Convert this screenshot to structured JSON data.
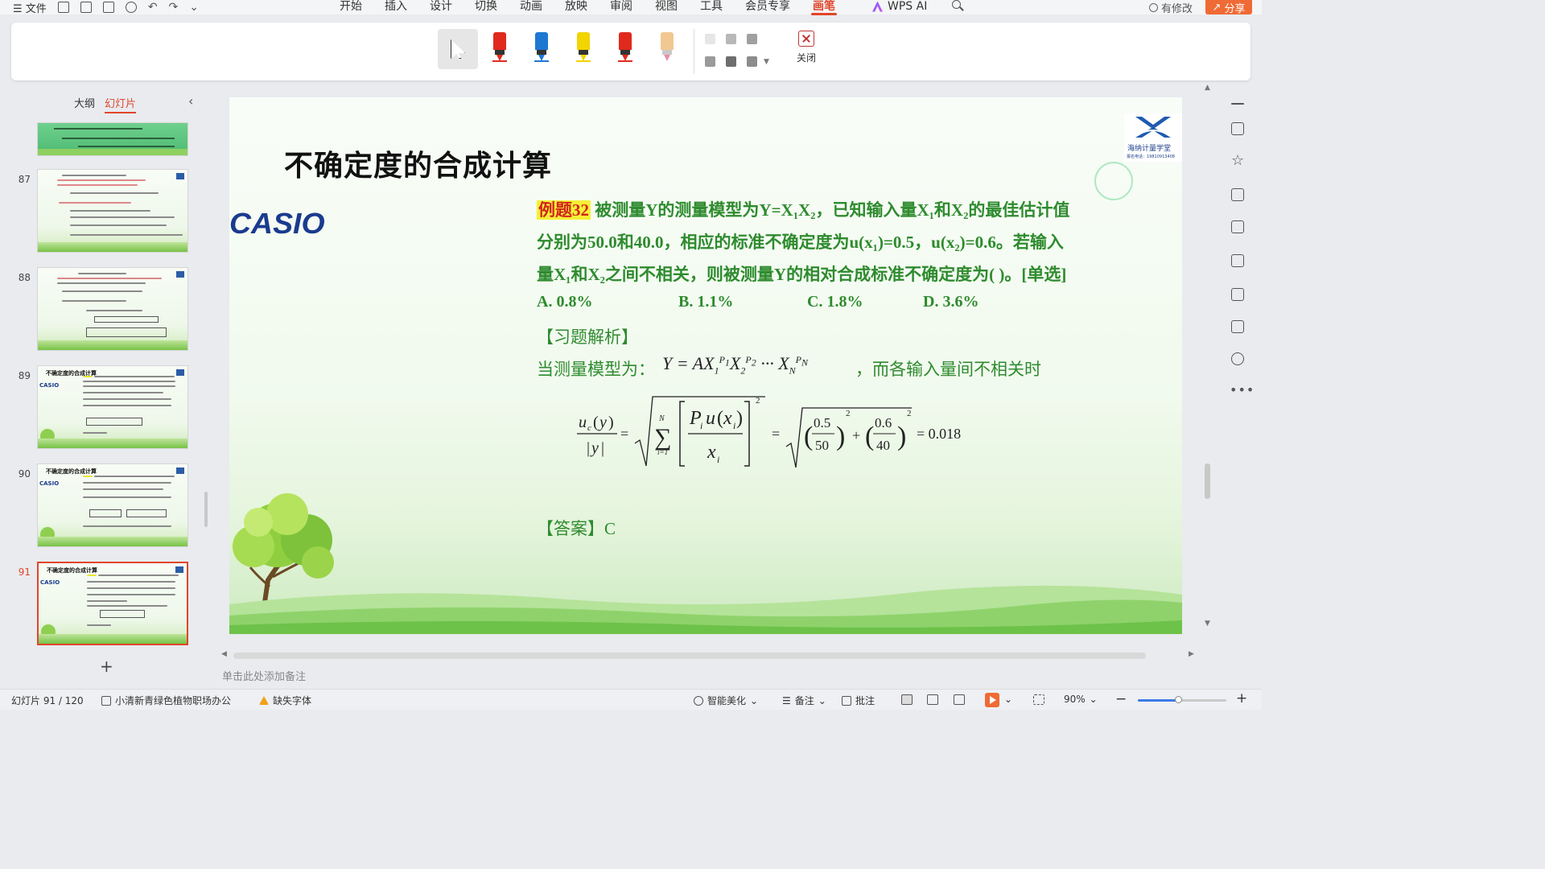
{
  "menubar": {
    "file_label": "文件",
    "tabs": [
      "开始",
      "插入",
      "设计",
      "切换",
      "动画",
      "放映",
      "审阅",
      "视图",
      "工具",
      "会员专享",
      "画笔"
    ],
    "active_tab": "画笔",
    "wps_ai_label": "WPS AI",
    "has_changes_label": "有修改",
    "share_label": "分享"
  },
  "pen_toolbar": {
    "pens": [
      {
        "name": "red-pen",
        "color": "#e02a1e"
      },
      {
        "name": "blue-pen",
        "color": "#1e78d2"
      },
      {
        "name": "yellow-highlighter",
        "color": "#f2d400"
      },
      {
        "name": "red-marker",
        "color": "#e02a1e"
      },
      {
        "name": "eraser",
        "color": "#f0c890"
      }
    ],
    "close_label": "关闭"
  },
  "left_panel": {
    "tabs": [
      "大纲",
      "幻灯片"
    ],
    "active_tab": "幻灯片",
    "slide_numbers": [
      "87",
      "88",
      "89",
      "90",
      "91"
    ],
    "current_slide": "91",
    "thumb_title": "不确定度的合成计算",
    "thumb_logo": "CASIO"
  },
  "slide": {
    "title": "不确定度的合成计算",
    "brand": "CASIO",
    "corner_logo_name": "海纳计量学堂",
    "corner_logo_phone": "报名电话：19810913408",
    "question_tag": "例题32",
    "question_line1": "被测量Y的测量模型为Y=X₁X₂，已知输入量X₁和X₂的最佳估计值",
    "question_line2": "分别为50.0和40.0，相应的标准不确定度为u(x₁)=0.5，u(x₂)=0.6。若输入",
    "question_line3": "量X₁和X₂之间不相关，则被测量Y的相对合成标准不确定度为(    )。[单选]",
    "options": [
      "A. 0.8%",
      "B. 1.1%",
      "C. 1.8%",
      "D. 3.6%"
    ],
    "analysis_label": "【习题解析】",
    "model_label": "当测量模型为：",
    "model_tail": "，而各输入量间不相关时",
    "result_value": "= 0.018",
    "answer_label": "【答案】",
    "answer_value": "C"
  },
  "notes_placeholder": "单击此处添加备注",
  "statusbar": {
    "slide_indicator": "幻灯片 91 / 120",
    "theme_name": "小清新青绿色植物职场办公",
    "missing_fonts": "缺失字体",
    "smart_beautify": "智能美化",
    "notes": "备注",
    "comments": "批注",
    "zoom": "90%",
    "zoom_level": 0.45
  },
  "colors": {
    "accent": "#e0462b",
    "slide_text_green": "#2e8b2e",
    "highlight_yellow": "#f5f036",
    "casio_blue": "#1a3b8e",
    "share_orange": "#f06a35"
  }
}
